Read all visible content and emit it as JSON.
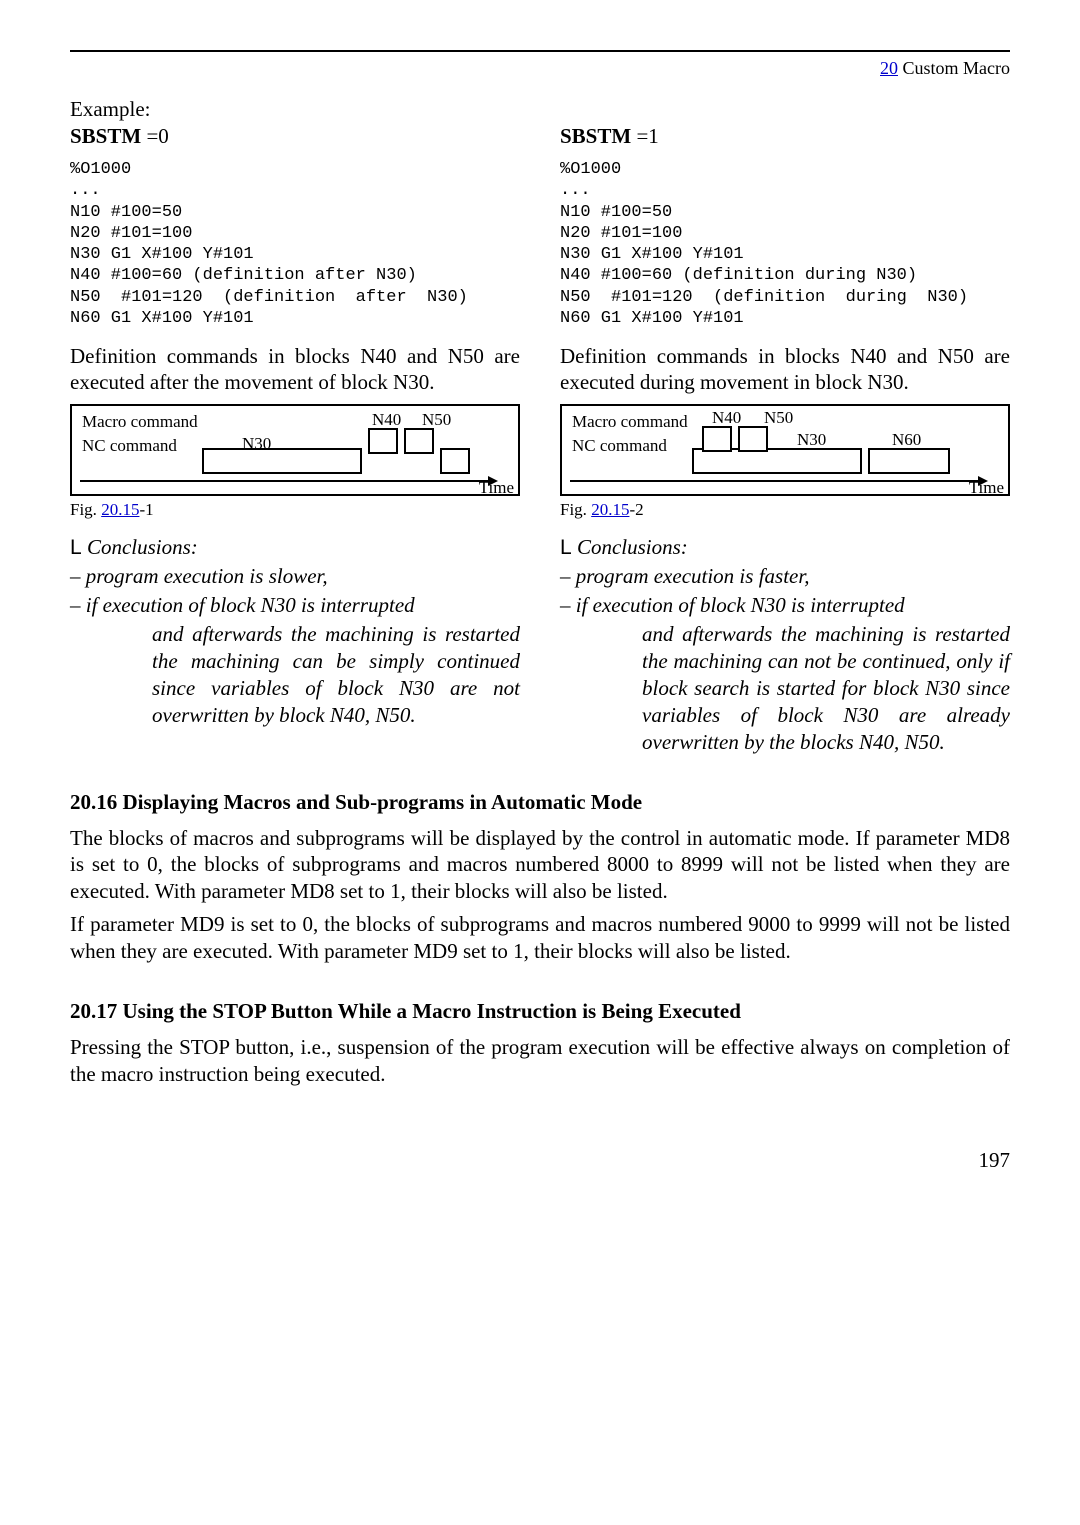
{
  "header": {
    "chap_num": "20",
    "chap_title": " Custom Macro"
  },
  "left": {
    "example_label": "Example:",
    "sbstm_label": "SBSTM",
    "sbstm_value": " =0",
    "code": "%O1000\n...\nN10 #100=50\nN20 #101=100\nN30 G1 X#100 Y#101\nN40 #100=60 (definition after N30)\nN50  #101=120  (definition  after  N30)\nN60 G1 X#100 Y#101",
    "def_para": "Definition commands in blocks N40 and N50 are executed after the movement of block N30.",
    "dia": {
      "macro_label": "Macro command",
      "nc_label": "NC command",
      "n30": "N30",
      "n40": "N40",
      "n50": "N50",
      "time": "Time"
    },
    "fig_prefix": "Fig. ",
    "fig_link": "20.15",
    "fig_suffix": "-1",
    "concl_head_L": "L",
    "concl_head": "  Conclusions:",
    "concl_1": " – program execution is slower,",
    "concl_2a": " – if execution of block N30 is interrupted",
    "concl_2b": "and afterwards the machining is restarted the machining can be simply continued since variables of block N30 are not overwritten by block N40, N50."
  },
  "right": {
    "sbstm_label": "SBSTM",
    "sbstm_value": " =1",
    "code": "%O1000\n...\nN10 #100=50\nN20 #101=100\nN30 G1 X#100 Y#101\nN40 #100=60 (definition during N30)\nN50  #101=120  (definition  during  N30)\nN60 G1 X#100 Y#101",
    "def_para": "Definition commands in blocks N40 and N50 are executed during movement in block N30.",
    "dia": {
      "macro_label": "Macro command",
      "nc_label": "NC command",
      "n30": "N30",
      "n40": "N40",
      "n50": "N50",
      "time": "Time"
    },
    "fig_prefix": "Fig. ",
    "fig_link": "20.15",
    "fig_suffix": "-2",
    "concl_head_L": "L",
    "concl_head": "  Conclusions:",
    "concl_1": " – program execution is faster,",
    "concl_2a": " – if execution of block N30 is interrupted",
    "concl_2b": "and afterwards the machining is restarted the machining can not be continued, only if block search is started for block N30 since variables of block N30 are already overwritten by the blocks N40, N50."
  },
  "sec16": {
    "title": "20.16 Displaying Macros and Sub-programs in Automatic Mode",
    "p1": "The blocks of macros and subprograms will be displayed by the control in automatic mode. If parameter MD8 is set to 0, the blocks of subprograms and macros numbered 8000 to 8999 will not be listed when they are executed. With parameter MD8 set to 1, their blocks will also be listed.",
    "p2": "If parameter MD9 is set to 0, the blocks of subprograms and macros numbered 9000 to 9999 will not be listed when they are executed. With parameter MD9 set to 1, their blocks will also be listed."
  },
  "sec17": {
    "title": "20.17 Using the STOP Button While a Macro Instruction is Being Executed",
    "p1": "Pressing the STOP button, i.e., suspension of the program execution will be effective always on completion of the macro instruction being executed."
  },
  "page_number": "197"
}
